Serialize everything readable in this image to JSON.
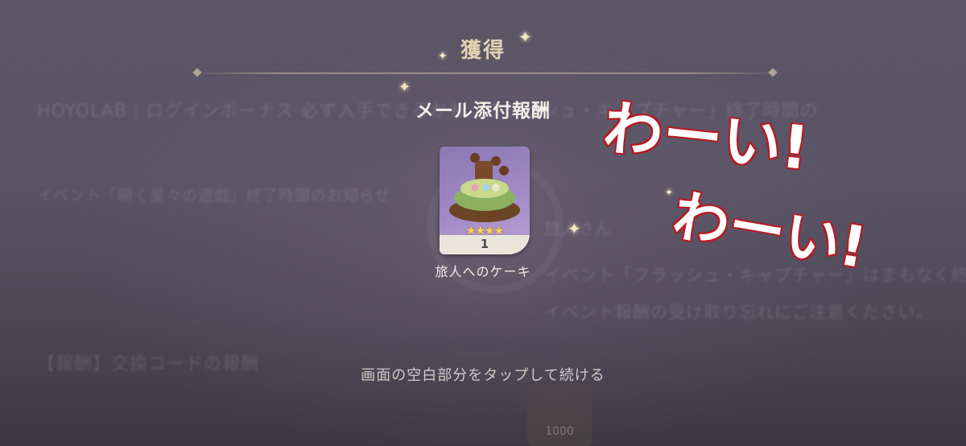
{
  "background": {
    "line1": "HOYOLAB｜ログインボーナス 必ず入手できるかも「フラッシュ・キャプチャー」終了時間の",
    "line2": "イベント「瞬く星々の遊戯」終了時間のお知らせ",
    "line3": "旅人さん",
    "line4": "イベント「フラッシュ・キャプチャー」はまもなく終",
    "line5": "イベント報酬の受け取り忘れにご注意ください。",
    "line6": "【報酬】交換コードの報酬",
    "bottom_button_value": "1000"
  },
  "dialog": {
    "title": "獲得",
    "subtitle": "メール添付報酬",
    "footer_hint": "画面の空白部分をタップして続ける"
  },
  "reward": {
    "name": "旅人へのケーキ",
    "count": "1",
    "rarity_stars": "★★★★",
    "rarity": 4,
    "icon": "cake-icon"
  },
  "overlay": {
    "line1": "わーい!",
    "line2": "わーい!",
    "color": "#b51c22"
  }
}
